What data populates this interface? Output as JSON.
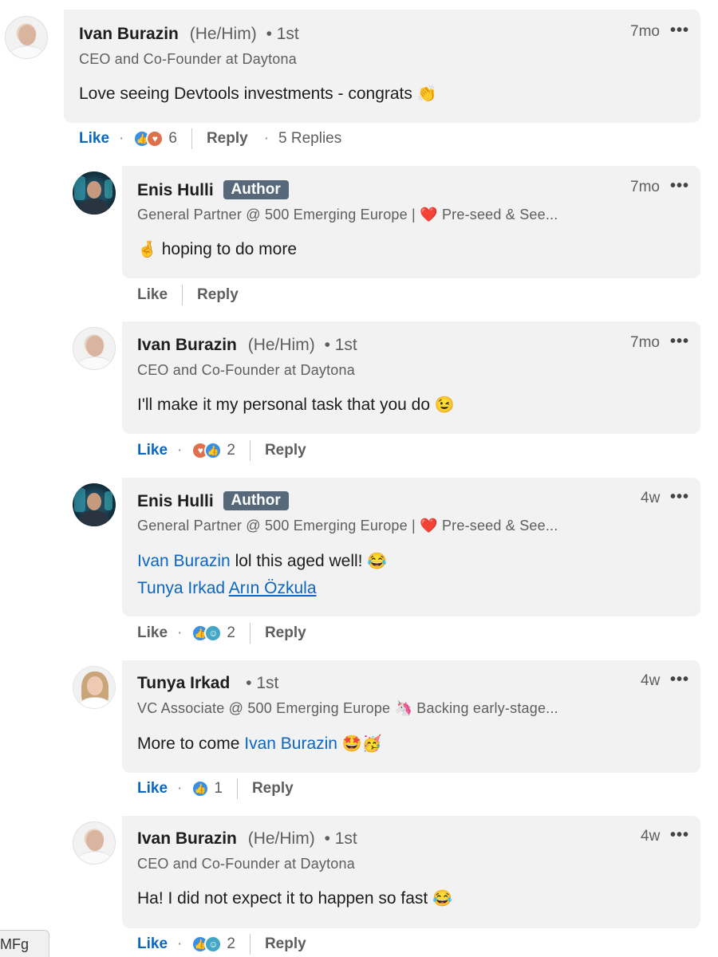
{
  "comments": [
    {
      "name": "Ivan Burazin",
      "pronoun": "(He/Him)",
      "degree": "• 1st",
      "headline": "CEO and Co-Founder at Daytona",
      "time": "7mo",
      "text": "Love seeing Devtools investments - congrats",
      "emoji": "👏",
      "like_label": "Like",
      "reaction_count": "6",
      "reply_label": "Reply",
      "replies_label": "5 Replies"
    },
    {
      "name": "Enis Hulli",
      "badge": "Author",
      "headline_prefix": "General Partner @ 500 Emerging Europe |",
      "headline_emoji": "❤️",
      "headline_suffix": "Pre-seed & See...",
      "time": "7mo",
      "emoji": "🤞",
      "text": "hoping to do more",
      "like_label": "Like",
      "reply_label": "Reply"
    },
    {
      "name": "Ivan Burazin",
      "pronoun": "(He/Him)",
      "degree": "• 1st",
      "headline": "CEO and Co-Founder at Daytona",
      "time": "7mo",
      "text": "I'll make it my personal task that you do",
      "emoji": "😉",
      "like_label": "Like",
      "reaction_count": "2",
      "reply_label": "Reply"
    },
    {
      "name": "Enis Hulli",
      "badge": "Author",
      "headline_prefix": "General Partner @ 500 Emerging Europe |",
      "headline_emoji": "❤️",
      "headline_suffix": "Pre-seed & See...",
      "time": "4w",
      "mention1": "Ivan Burazin",
      "text": "lol this aged well!",
      "emoji": "😂",
      "mention2": "Tunya Irkad",
      "mention3": "Arın Özkula",
      "like_label": "Like",
      "reaction_count": "2",
      "reply_label": "Reply"
    },
    {
      "name": "Tunya Irkad",
      "degree": "• 1st",
      "headline_prefix": "VC Associate @ 500 Emerging Europe",
      "headline_emoji": "🦄",
      "headline_suffix": "Backing early-stage...",
      "time": "4w",
      "text": "More to come",
      "mention": "Ivan Burazin",
      "emoji": "🤩🥳",
      "like_label": "Like",
      "reaction_count": "1",
      "reply_label": "Reply"
    },
    {
      "name": "Ivan Burazin",
      "pronoun": "(He/Him)",
      "degree": "• 1st",
      "headline": "CEO and Co-Founder at Daytona",
      "time": "4w",
      "text": "Ha! I did not expect it to happen so fast",
      "emoji": "😂",
      "like_label": "Like",
      "reaction_count": "2",
      "reply_label": "Reply"
    }
  ],
  "more_icon": "•••",
  "separator_dot": "·",
  "corner_tab": "MFg"
}
